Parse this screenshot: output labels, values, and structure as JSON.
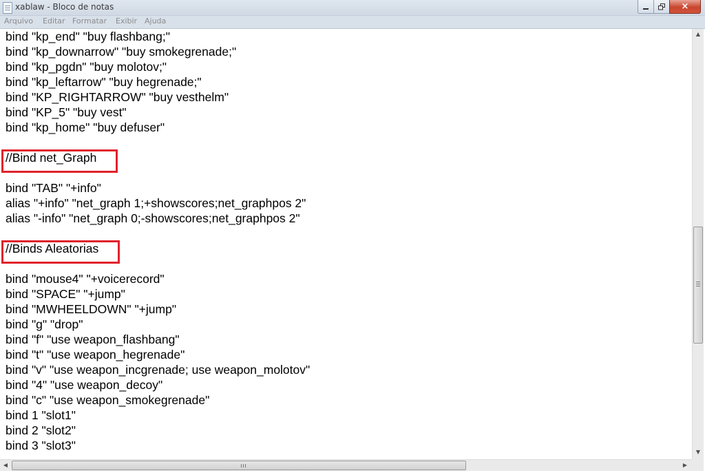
{
  "window": {
    "title": "xablaw - Bloco de notas",
    "close_glyph": "×",
    "accent_close_color": "#c9462f"
  },
  "menu": {
    "items": [
      "Arquivo",
      "Editar",
      "Formatar",
      "Exibir",
      "Ajuda"
    ]
  },
  "editor": {
    "lines": [
      "bind \"kp_end\" \"buy flashbang;\"",
      "bind \"kp_downarrow\" \"buy smokegrenade;\"",
      "bind \"kp_pgdn\" \"buy molotov;\"",
      "bind \"kp_leftarrow\" \"buy hegrenade;\"",
      "bind \"KP_RIGHTARROW\" \"buy vesthelm\"",
      "bind \"KP_5\" \"buy vest\"",
      "bind \"kp_home\" \"buy defuser\"",
      "",
      "//Bind net_Graph",
      "",
      "bind \"TAB\" \"+info\"",
      "alias \"+info\" \"net_graph 1;+showscores;net_graphpos 2\"",
      "alias \"-info\" \"net_graph 0;-showscores;net_graphpos 2\"",
      "",
      "//Binds Aleatorias",
      "",
      "bind \"mouse4\" \"+voicerecord\"",
      "bind \"SPACE\" \"+jump\"",
      "bind \"MWHEELDOWN\" \"+jump\"",
      "bind \"g\" \"drop\"",
      "bind \"f\" \"use weapon_flashbang\"",
      "bind \"t\" \"use weapon_hegrenade\"",
      "bind \"v\" \"use weapon_incgrenade; use weapon_molotov\"",
      "bind \"4\" \"use weapon_decoy\"",
      "bind \"c\" \"use weapon_smokegrenade\"",
      "bind 1 \"slot1\"",
      "bind 2 \"slot2\"",
      "bind 3 \"slot3\""
    ],
    "highlight_color": "#e0222c"
  }
}
